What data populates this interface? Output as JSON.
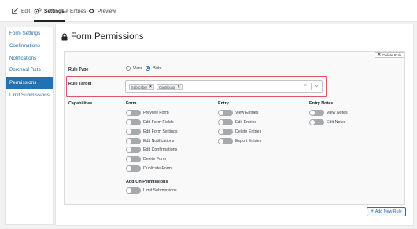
{
  "tabs": [
    {
      "label": "Edit",
      "icon": "pencil-icon"
    },
    {
      "label": "Settings",
      "icon": "gears-icon",
      "active": true
    },
    {
      "label": "Entries",
      "icon": "speech-bubble-icon"
    },
    {
      "label": "Preview",
      "icon": "eye-icon"
    }
  ],
  "sidebar": {
    "items": [
      {
        "label": "Form Settings"
      },
      {
        "label": "Confirmations"
      },
      {
        "label": "Notifications"
      },
      {
        "label": "Personal Data"
      },
      {
        "label": "Permissions",
        "active": true
      },
      {
        "label": "Limit Submissions"
      }
    ]
  },
  "page": {
    "title": "Form Permissions",
    "title_icon": "lock-icon"
  },
  "rule": {
    "delete_label": "Delete Rule",
    "rule_type_label": "Rule Type",
    "rule_type_options": [
      "User",
      "Role"
    ],
    "rule_type_selected": "Role",
    "rule_target_label": "Rule Target",
    "targets": [
      "Subscriber",
      "Contributor"
    ],
    "capabilities_label": "Capabilities",
    "form_heading": "Form",
    "form_perms": [
      "Preview Form",
      "Edit Form Fields",
      "Edit Form Settings",
      "Edit Notifications",
      "Edit Confirmations",
      "Delete Form",
      "Duplicate Form"
    ],
    "addon_heading": "Add-On Permissions",
    "addon_perms": [
      "Limit Submissions"
    ],
    "entry_heading": "Entry",
    "entry_perms": [
      "View Entries",
      "Edit Entries",
      "Delete Entries",
      "Export Entries"
    ],
    "notes_heading": "Entry Notes",
    "notes_perms": [
      "View Notes",
      "Edit Notes"
    ]
  },
  "add_rule_label": "Add New Rule",
  "colors": {
    "accent": "#2271b1",
    "highlight": "#e05565",
    "toggle_off": "#a7aaad"
  }
}
